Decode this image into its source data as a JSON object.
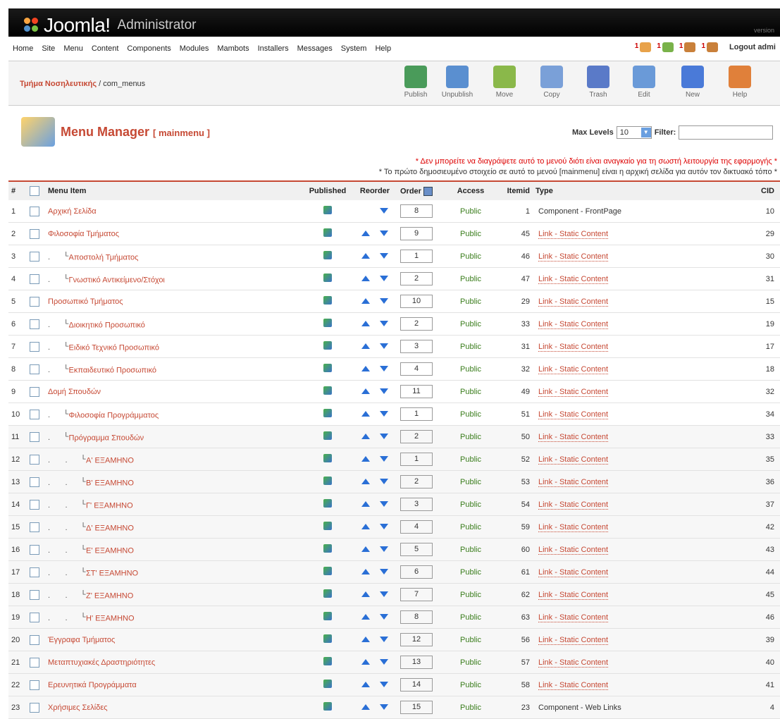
{
  "header": {
    "brand": "Joomla!",
    "admin": "Administrator",
    "version": "version"
  },
  "menubar": {
    "items": [
      "Home",
      "Site",
      "Menu",
      "Content",
      "Components",
      "Modules",
      "Mambots",
      "Installers",
      "Messages",
      "System",
      "Help"
    ],
    "stats": [
      "1",
      "1",
      "1",
      "1"
    ],
    "logout": "Logout admi"
  },
  "toolbar": {
    "site": "Τμήμα Νοσηλευτικής",
    "path": " / com_menus",
    "buttons": [
      "Publish",
      "Unpublish",
      "Move",
      "Copy",
      "Trash",
      "Edit",
      "New",
      "Help"
    ]
  },
  "title": {
    "main": "Menu Manager",
    "sub": "[ mainmenu ]"
  },
  "filters": {
    "max_levels_label": "Max Levels",
    "max_levels_value": "10",
    "filter_label": "Filter:"
  },
  "notes": {
    "red": "* Δεν μπορείτε να διαγράψετε αυτό το μενού διότι είναι αναγκαίο για τη σωστή λειτουργία της εφαρμογής *",
    "black": "* Το πρώτο δημοσιευμένο στοιχείο σε αυτό το μενού [mainmenu] είναι η αρχική σελίδα για αυτόν τον δικτυακό τόπο *"
  },
  "columns": [
    "#",
    "Menu Item",
    "Published",
    "Reorder",
    "Order",
    "Access",
    "Itemid",
    "Type",
    "CID"
  ],
  "rows": [
    {
      "n": "1",
      "name": "Αρχική Σελίδα",
      "level": 0,
      "order": "8",
      "access": "Public",
      "itemid": "1",
      "type": "Component - FrontPage",
      "cid": "10",
      "up": false
    },
    {
      "n": "2",
      "name": "Φιλοσοφία Τμήματος",
      "level": 0,
      "order": "9",
      "access": "Public",
      "itemid": "45",
      "type": "Link - Static Content",
      "cid": "29",
      "up": true
    },
    {
      "n": "3",
      "name": "Αποστολή Τμήματος",
      "level": 1,
      "order": "1",
      "access": "Public",
      "itemid": "46",
      "type": "Link - Static Content",
      "cid": "30",
      "up": true
    },
    {
      "n": "4",
      "name": "Γνωστικό Αντικείμενο/Στόχοι",
      "level": 1,
      "order": "2",
      "access": "Public",
      "itemid": "47",
      "type": "Link - Static Content",
      "cid": "31",
      "up": true
    },
    {
      "n": "5",
      "name": "Προσωπικό Τμήματος",
      "level": 0,
      "order": "10",
      "access": "Public",
      "itemid": "29",
      "type": "Link - Static Content",
      "cid": "15",
      "up": true
    },
    {
      "n": "6",
      "name": "Διοικητικό Προσωπικό",
      "level": 1,
      "order": "2",
      "access": "Public",
      "itemid": "33",
      "type": "Link - Static Content",
      "cid": "19",
      "up": true
    },
    {
      "n": "7",
      "name": "Ειδικό Τεχνικό Προσωπικό",
      "level": 1,
      "order": "3",
      "access": "Public",
      "itemid": "31",
      "type": "Link - Static Content",
      "cid": "17",
      "up": true
    },
    {
      "n": "8",
      "name": "Εκπαιδευτικό Προσωπικό",
      "level": 1,
      "order": "4",
      "access": "Public",
      "itemid": "32",
      "type": "Link - Static Content",
      "cid": "18",
      "up": true
    },
    {
      "n": "9",
      "name": "Δομή Σπουδών",
      "level": 0,
      "order": "11",
      "access": "Public",
      "itemid": "49",
      "type": "Link - Static Content",
      "cid": "32",
      "up": true
    },
    {
      "n": "10",
      "name": "Φιλοσοφία Προγράμματος",
      "level": 1,
      "order": "1",
      "access": "Public",
      "itemid": "51",
      "type": "Link - Static Content",
      "cid": "34",
      "up": true
    },
    {
      "n": "11",
      "name": "Πρόγραμμα Σπουδών",
      "level": 1,
      "order": "2",
      "access": "Public",
      "itemid": "50",
      "type": "Link - Static Content",
      "cid": "33",
      "up": true
    },
    {
      "n": "12",
      "name": "Α' ΕΞΑΜΗΝΟ",
      "level": 2,
      "order": "1",
      "access": "Public",
      "itemid": "52",
      "type": "Link - Static Content",
      "cid": "35",
      "up": true
    },
    {
      "n": "13",
      "name": "Β' ΕΞΑΜΗΝΟ",
      "level": 2,
      "order": "2",
      "access": "Public",
      "itemid": "53",
      "type": "Link - Static Content",
      "cid": "36",
      "up": true
    },
    {
      "n": "14",
      "name": "Γ' ΕΞΑΜΗΝΟ",
      "level": 2,
      "order": "3",
      "access": "Public",
      "itemid": "54",
      "type": "Link - Static Content",
      "cid": "37",
      "up": true
    },
    {
      "n": "15",
      "name": "Δ' ΕΞΑΜΗΝΟ",
      "level": 2,
      "order": "4",
      "access": "Public",
      "itemid": "59",
      "type": "Link - Static Content",
      "cid": "42",
      "up": true
    },
    {
      "n": "16",
      "name": "Ε' ΕΞΑΜΗΝΟ",
      "level": 2,
      "order": "5",
      "access": "Public",
      "itemid": "60",
      "type": "Link - Static Content",
      "cid": "43",
      "up": true
    },
    {
      "n": "17",
      "name": "ΣΤ' ΕΞΑΜΗΝΟ",
      "level": 2,
      "order": "6",
      "access": "Public",
      "itemid": "61",
      "type": "Link - Static Content",
      "cid": "44",
      "up": true
    },
    {
      "n": "18",
      "name": "Ζ' ΕΞΑΜΗΝΟ",
      "level": 2,
      "order": "7",
      "access": "Public",
      "itemid": "62",
      "type": "Link - Static Content",
      "cid": "45",
      "up": true
    },
    {
      "n": "19",
      "name": "Η' ΕΞΑΜΗΝΟ",
      "level": 2,
      "order": "8",
      "access": "Public",
      "itemid": "63",
      "type": "Link - Static Content",
      "cid": "46",
      "up": true
    },
    {
      "n": "20",
      "name": "Έγγραφα Τμήματος",
      "level": 0,
      "order": "12",
      "access": "Public",
      "itemid": "56",
      "type": "Link - Static Content",
      "cid": "39",
      "up": true
    },
    {
      "n": "21",
      "name": "Μεταπτυχιακές Δραστηριότητες",
      "level": 0,
      "order": "13",
      "access": "Public",
      "itemid": "57",
      "type": "Link - Static Content",
      "cid": "40",
      "up": true
    },
    {
      "n": "22",
      "name": "Ερευνητικά Προγράμματα",
      "level": 0,
      "order": "14",
      "access": "Public",
      "itemid": "58",
      "type": "Link - Static Content",
      "cid": "41",
      "up": true
    },
    {
      "n": "23",
      "name": "Χρήσιμες Σελίδες",
      "level": 0,
      "order": "15",
      "access": "Public",
      "itemid": "23",
      "type": "Component - Web Links",
      "cid": "4",
      "up": true
    }
  ]
}
